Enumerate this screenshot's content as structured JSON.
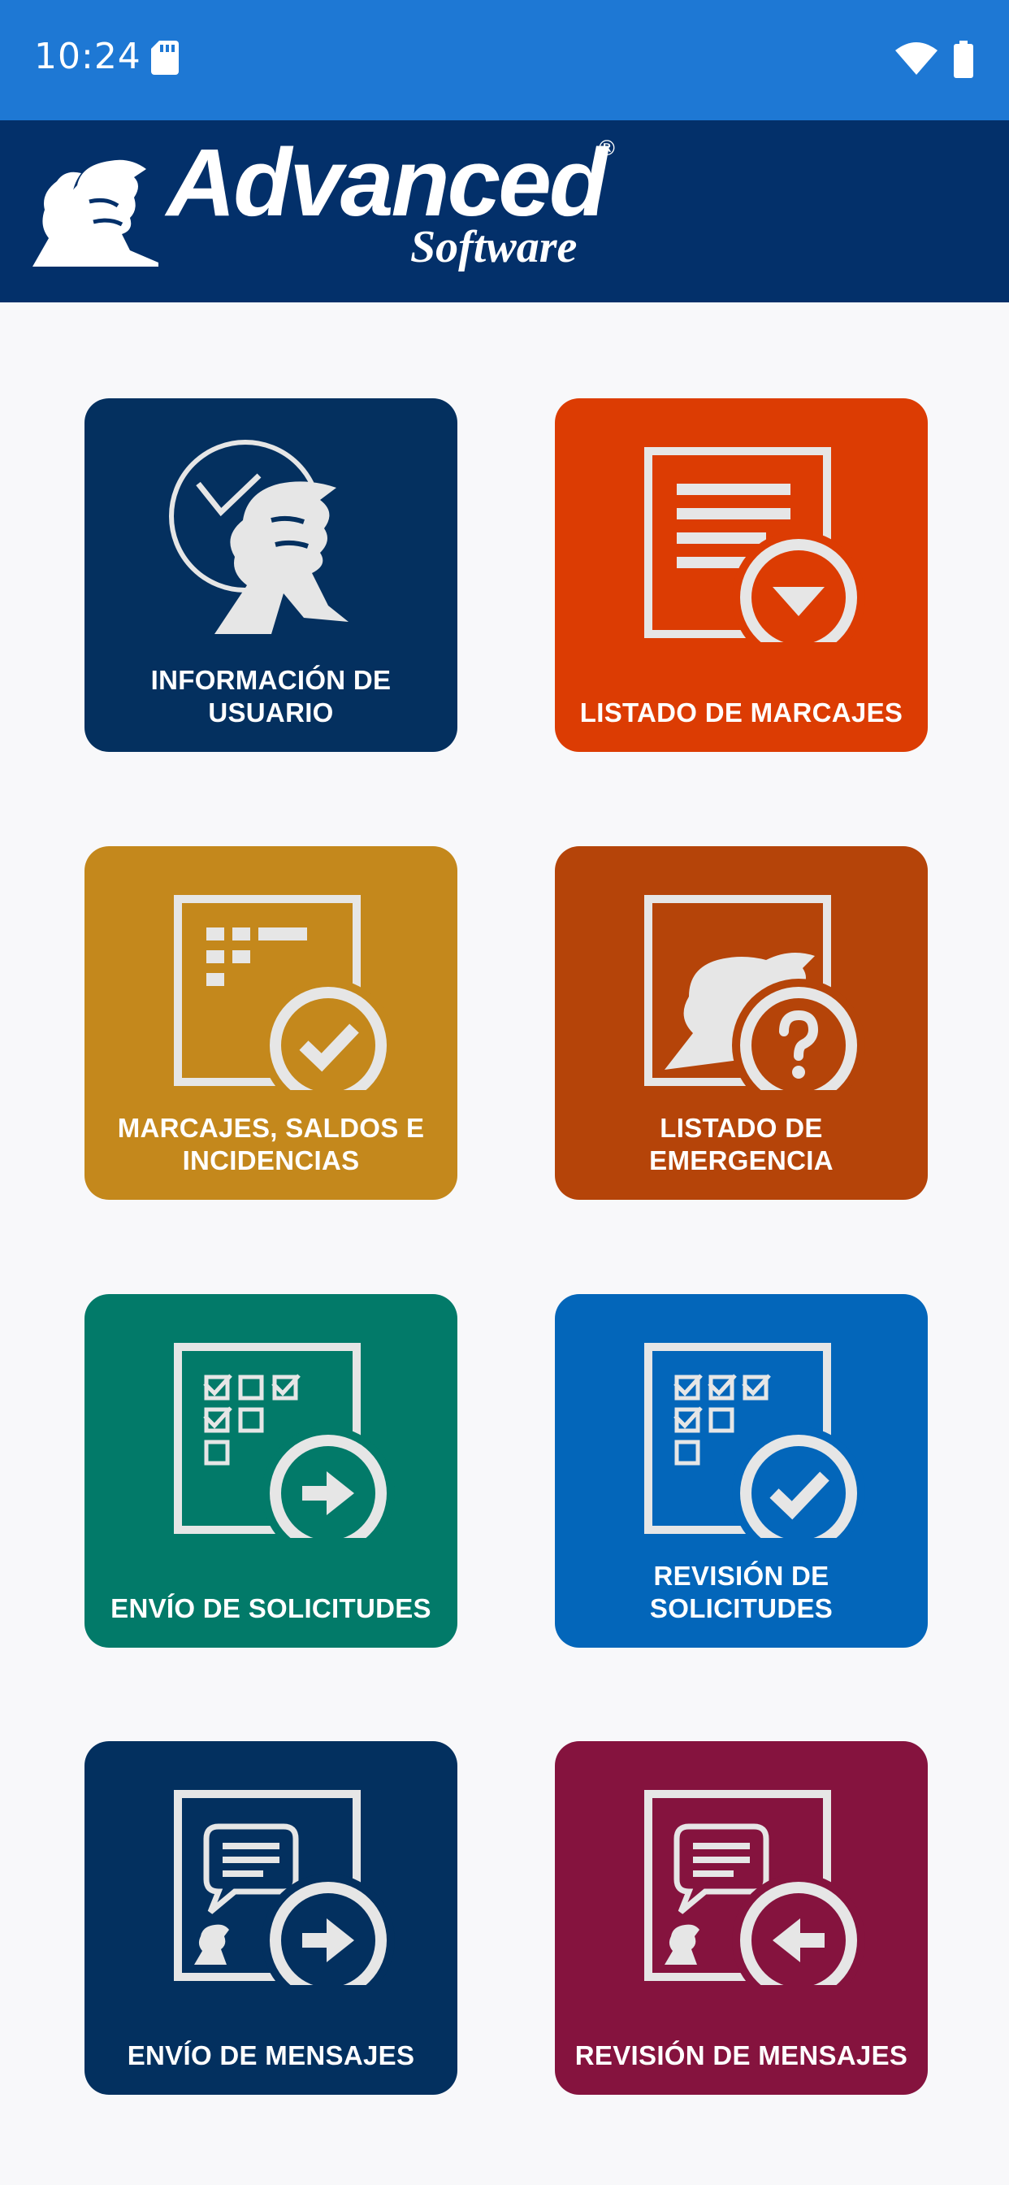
{
  "status_bar": {
    "time": "10:24",
    "icons": [
      "sd-card-icon",
      "wifi-icon",
      "battery-icon"
    ]
  },
  "brand": {
    "logo_word": "Advanced",
    "logo_sub": "Software",
    "registered_mark": "®"
  },
  "menu": {
    "items": [
      {
        "lines": [
          "INFORMACIÓN DE",
          "USUARIO"
        ],
        "color": "#04305f",
        "icon": "user-info-icon"
      },
      {
        "lines": [
          "LISTADO DE MARCAJES"
        ],
        "color": "#dc3c03",
        "icon": "records-list-icon"
      },
      {
        "lines": [
          "MARCAJES, SALDOS E",
          "INCIDENCIAS"
        ],
        "color": "#c4881c",
        "icon": "balance-check-icon"
      },
      {
        "lines": [
          "LISTADO DE",
          "EMERGENCIA"
        ],
        "color": "#b54409",
        "icon": "emergency-list-icon"
      },
      {
        "lines": [
          "ENVÍO DE SOLICITUDES"
        ],
        "color": "#027a69",
        "icon": "send-requests-icon"
      },
      {
        "lines": [
          "REVISIÓN DE",
          "SOLICITUDES"
        ],
        "color": "#0366ba",
        "icon": "review-requests-icon"
      },
      {
        "lines": [
          "ENVÍO DE MENSAJES"
        ],
        "color": "#03305f",
        "icon": "send-messages-icon"
      },
      {
        "lines": [
          "REVISIÓN DE MENSAJES"
        ],
        "color": "#85133e",
        "icon": "review-messages-icon"
      }
    ]
  }
}
